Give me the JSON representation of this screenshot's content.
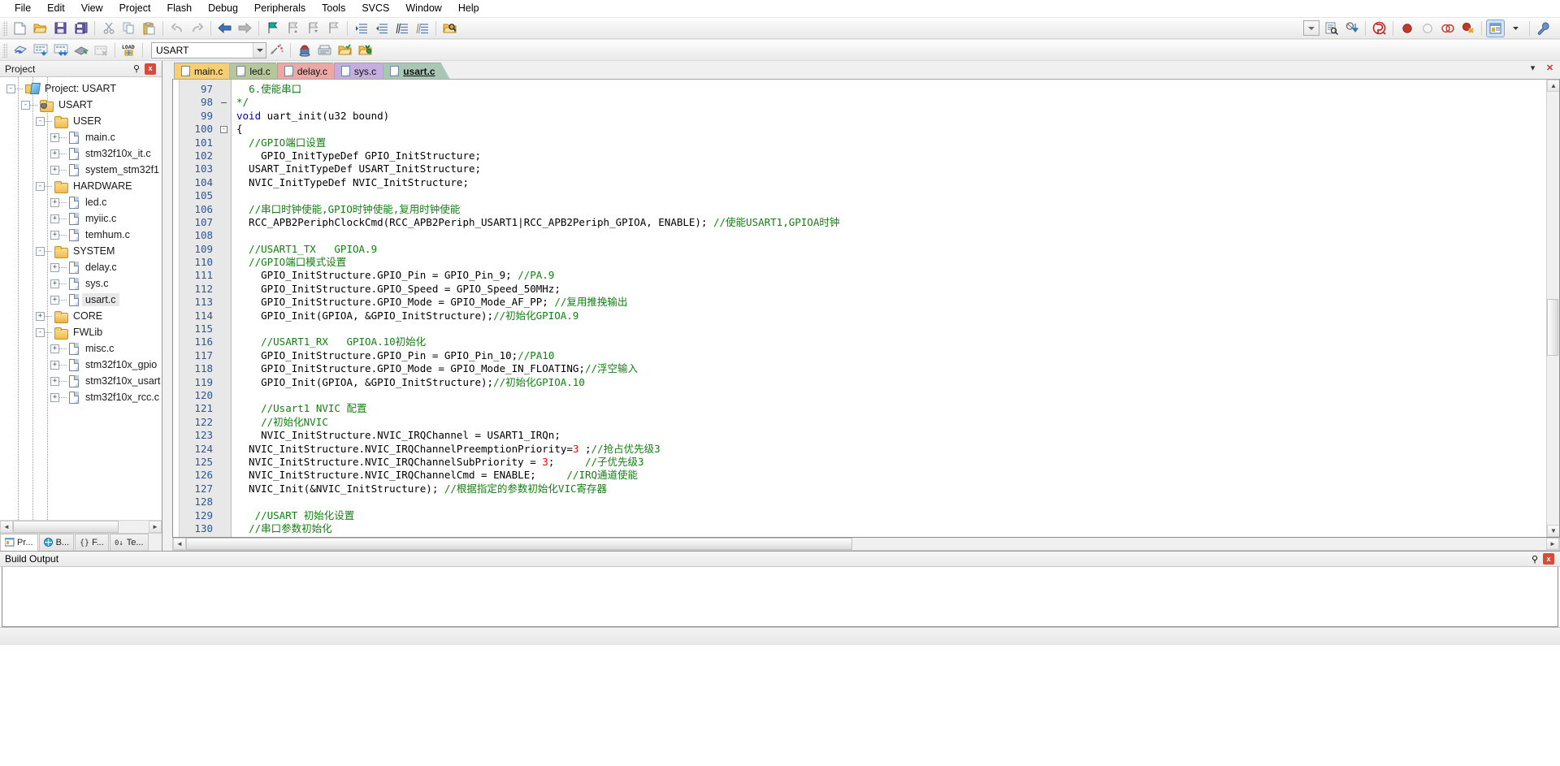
{
  "menubar": {
    "items": [
      {
        "label": "File"
      },
      {
        "label": "Edit"
      },
      {
        "label": "View"
      },
      {
        "label": "Project"
      },
      {
        "label": "Flash"
      },
      {
        "label": "Debug"
      },
      {
        "label": "Peripherals"
      },
      {
        "label": "Tools"
      },
      {
        "label": "SVCS"
      },
      {
        "label": "Window"
      },
      {
        "label": "Help"
      }
    ]
  },
  "toolbar1": {
    "icons": [
      "new-file-icon",
      "open-file-icon",
      "save-icon",
      "save-all-icon",
      "cut-icon",
      "copy-icon",
      "paste-icon",
      "undo-icon",
      "redo-icon",
      "navigate-back-icon",
      "navigate-forward-icon",
      "bookmark-toggle-icon",
      "bookmark-prev-icon",
      "bookmark-next-icon",
      "bookmark-clear-icon",
      "indent-icon",
      "outdent-icon",
      "comment-icon",
      "uncomment-icon",
      "find-in-files-icon",
      "dropdown-icon",
      "configure-icon",
      "debug-download-icon",
      "start-debug-icon",
      "insert-breakpoint-icon",
      "disable-breakpoint-icon",
      "kill-all-breakpoints-icon",
      "disable-all-breakpoints-icon",
      "project-window-icon",
      "project-window-dropdown-icon",
      "configure-target-icon"
    ]
  },
  "toolbar2": {
    "icons": [
      "translate-icon",
      "build-icon",
      "rebuild-icon",
      "batch-build-icon",
      "stop-build-icon",
      "load-icon"
    ],
    "target_select": {
      "value": "USART",
      "name": "target-select"
    },
    "right_icons": [
      "blank-icon",
      "manage-runtime-icon",
      "target-options-icon",
      "manage-project-icon",
      "pack-installer-icon"
    ]
  },
  "project_pane": {
    "title": "Project",
    "pin_label": "⚲",
    "close_label": "x",
    "tree": [
      {
        "depth": 0,
        "label": "Project: USART",
        "icon": "project-icon",
        "expander": "-",
        "selected": false
      },
      {
        "depth": 1,
        "label": "USART",
        "icon": "target-folder-icon",
        "expander": "-",
        "selected": false
      },
      {
        "depth": 2,
        "label": "USER",
        "icon": "folder-icon",
        "expander": "-",
        "selected": false
      },
      {
        "depth": 3,
        "label": "main.c",
        "icon": "c-file-icon",
        "expander": "+",
        "selected": false
      },
      {
        "depth": 3,
        "label": "stm32f10x_it.c",
        "icon": "c-file-icon",
        "expander": "+",
        "selected": false
      },
      {
        "depth": 3,
        "label": "system_stm32f1",
        "icon": "c-file-icon",
        "expander": "+",
        "selected": false
      },
      {
        "depth": 2,
        "label": "HARDWARE",
        "icon": "folder-icon",
        "expander": "-",
        "selected": false
      },
      {
        "depth": 3,
        "label": "led.c",
        "icon": "c-file-icon",
        "expander": "+",
        "selected": false
      },
      {
        "depth": 3,
        "label": "myiic.c",
        "icon": "c-file-icon",
        "expander": "+",
        "selected": false
      },
      {
        "depth": 3,
        "label": "temhum.c",
        "icon": "c-file-icon",
        "expander": "+",
        "selected": false
      },
      {
        "depth": 2,
        "label": "SYSTEM",
        "icon": "folder-icon",
        "expander": "-",
        "selected": false
      },
      {
        "depth": 3,
        "label": "delay.c",
        "icon": "c-file-icon",
        "expander": "+",
        "selected": false
      },
      {
        "depth": 3,
        "label": "sys.c",
        "icon": "c-file-icon",
        "expander": "+",
        "selected": false
      },
      {
        "depth": 3,
        "label": "usart.c",
        "icon": "c-file-icon",
        "expander": "+",
        "selected": true
      },
      {
        "depth": 2,
        "label": "CORE",
        "icon": "folder-closed-icon",
        "expander": "+",
        "selected": false
      },
      {
        "depth": 2,
        "label": "FWLib",
        "icon": "folder-icon",
        "expander": "-",
        "selected": false
      },
      {
        "depth": 3,
        "label": "misc.c",
        "icon": "c-file-icon",
        "expander": "+",
        "selected": false
      },
      {
        "depth": 3,
        "label": "stm32f10x_gpio",
        "icon": "c-file-icon",
        "expander": "+",
        "selected": false
      },
      {
        "depth": 3,
        "label": "stm32f10x_usart",
        "icon": "c-file-icon",
        "expander": "+",
        "selected": false
      },
      {
        "depth": 3,
        "label": "stm32f10x_rcc.c",
        "icon": "c-file-icon",
        "expander": "+",
        "selected": false
      }
    ],
    "bottom_tabs": [
      {
        "label": "Pr...",
        "icon": "project-tab-icon",
        "active": true
      },
      {
        "label": "B...",
        "icon": "books-tab-icon",
        "active": false
      },
      {
        "label": "F...",
        "icon": "functions-tab-icon",
        "active": false
      },
      {
        "label": "Te...",
        "icon": "templates-tab-icon",
        "active": false
      }
    ]
  },
  "editor": {
    "tabs": [
      {
        "label": "main.c",
        "color": "#f5cf72",
        "active": false
      },
      {
        "label": "led.c",
        "color": "#b6c89b",
        "active": false
      },
      {
        "label": "delay.c",
        "color": "#eda8a5",
        "active": false
      },
      {
        "label": "sys.c",
        "color": "#c5aede",
        "active": false
      },
      {
        "label": "usart.c",
        "color": "#a9c7b5",
        "active": true
      }
    ],
    "tab_controls": [
      {
        "name": "tab-list-dropdown-icon",
        "label": "▾"
      },
      {
        "name": "close-tab-icon",
        "label": "✕"
      }
    ],
    "first_line": 97,
    "lines": [
      {
        "n": 97,
        "fold": "",
        "segments": [
          {
            "t": "  ",
            "c": ""
          },
          {
            "t": "6.使能串口",
            "c": "cmt"
          }
        ]
      },
      {
        "n": 98,
        "fold": "|",
        "segments": [
          {
            "t": "*/",
            "c": "cmt"
          }
        ]
      },
      {
        "n": 99,
        "fold": "",
        "segments": [
          {
            "t": "void ",
            "c": "kw"
          },
          {
            "t": "uart_init(u32 bound)",
            "c": ""
          }
        ]
      },
      {
        "n": 100,
        "fold": "-",
        "segments": [
          {
            "t": "{",
            "c": ""
          }
        ]
      },
      {
        "n": 101,
        "fold": "",
        "segments": [
          {
            "t": "  //GPIO端口设置",
            "c": "cmt"
          }
        ]
      },
      {
        "n": 102,
        "fold": "",
        "segments": [
          {
            "t": "    GPIO_InitTypeDef GPIO_InitStructure;",
            "c": ""
          }
        ]
      },
      {
        "n": 103,
        "fold": "",
        "segments": [
          {
            "t": "  USART_InitTypeDef USART_InitStructure;",
            "c": ""
          }
        ]
      },
      {
        "n": 104,
        "fold": "",
        "segments": [
          {
            "t": "  NVIC_InitTypeDef NVIC_InitStructure;",
            "c": ""
          }
        ]
      },
      {
        "n": 105,
        "fold": "",
        "segments": [
          {
            "t": "",
            "c": ""
          }
        ]
      },
      {
        "n": 106,
        "fold": "",
        "segments": [
          {
            "t": "  //串口时钟使能,GPIO时钟使能,复用时钟使能",
            "c": "cmt"
          }
        ]
      },
      {
        "n": 107,
        "fold": "",
        "segments": [
          {
            "t": "  RCC_APB2PeriphClockCmd(RCC_APB2Periph_USART1|RCC_APB2Periph_GPIOA, ENABLE); ",
            "c": ""
          },
          {
            "t": "//使能USART1,GPIOA时钟",
            "c": "cmt"
          }
        ]
      },
      {
        "n": 108,
        "fold": "",
        "segments": [
          {
            "t": "",
            "c": ""
          }
        ]
      },
      {
        "n": 109,
        "fold": "",
        "segments": [
          {
            "t": "  //USART1_TX   GPIOA.9",
            "c": "cmt"
          }
        ]
      },
      {
        "n": 110,
        "fold": "",
        "segments": [
          {
            "t": "  //GPIO端口模式设置",
            "c": "cmt"
          }
        ]
      },
      {
        "n": 111,
        "fold": "",
        "segments": [
          {
            "t": "    GPIO_InitStructure.GPIO_Pin = GPIO_Pin_9; ",
            "c": ""
          },
          {
            "t": "//PA.9",
            "c": "cmt"
          }
        ]
      },
      {
        "n": 112,
        "fold": "",
        "segments": [
          {
            "t": "    GPIO_InitStructure.GPIO_Speed = GPIO_Speed_50MHz;",
            "c": ""
          }
        ]
      },
      {
        "n": 113,
        "fold": "",
        "segments": [
          {
            "t": "    GPIO_InitStructure.GPIO_Mode = GPIO_Mode_AF_PP; ",
            "c": ""
          },
          {
            "t": "//复用推挽输出",
            "c": "cmt"
          }
        ]
      },
      {
        "n": 114,
        "fold": "",
        "segments": [
          {
            "t": "    GPIO_Init(GPIOA, &GPIO_InitStructure);",
            "c": ""
          },
          {
            "t": "//初始化GPIOA.9",
            "c": "cmt"
          }
        ]
      },
      {
        "n": 115,
        "fold": "",
        "segments": [
          {
            "t": "",
            "c": ""
          }
        ]
      },
      {
        "n": 116,
        "fold": "",
        "segments": [
          {
            "t": "    //USART1_RX   GPIOA.10初始化",
            "c": "cmt"
          }
        ]
      },
      {
        "n": 117,
        "fold": "",
        "segments": [
          {
            "t": "    GPIO_InitStructure.GPIO_Pin = GPIO_Pin_10;",
            "c": ""
          },
          {
            "t": "//PA10",
            "c": "cmt"
          }
        ]
      },
      {
        "n": 118,
        "fold": "",
        "segments": [
          {
            "t": "    GPIO_InitStructure.GPIO_Mode = GPIO_Mode_IN_FLOATING;",
            "c": ""
          },
          {
            "t": "//浮空输入",
            "c": "cmt"
          }
        ]
      },
      {
        "n": 119,
        "fold": "",
        "segments": [
          {
            "t": "    GPIO_Init(GPIOA, &GPIO_InitStructure);",
            "c": ""
          },
          {
            "t": "//初始化GPIOA.10",
            "c": "cmt"
          }
        ]
      },
      {
        "n": 120,
        "fold": "",
        "segments": [
          {
            "t": "",
            "c": ""
          }
        ]
      },
      {
        "n": 121,
        "fold": "",
        "segments": [
          {
            "t": "    //Usart1 NVIC 配置",
            "c": "cmt"
          }
        ]
      },
      {
        "n": 122,
        "fold": "",
        "segments": [
          {
            "t": "    //初始化NVIC",
            "c": "cmt"
          }
        ]
      },
      {
        "n": 123,
        "fold": "",
        "segments": [
          {
            "t": "    NVIC_InitStructure.NVIC_IRQChannel = USART1_IRQn;",
            "c": ""
          }
        ]
      },
      {
        "n": 124,
        "fold": "",
        "segments": [
          {
            "t": "  NVIC_InitStructure.NVIC_IRQChannelPreemptionPriority=",
            "c": ""
          },
          {
            "t": "3",
            "c": "num"
          },
          {
            "t": " ;",
            "c": ""
          },
          {
            "t": "//抢占优先级3",
            "c": "cmt"
          }
        ]
      },
      {
        "n": 125,
        "fold": "",
        "segments": [
          {
            "t": "  NVIC_InitStructure.NVIC_IRQChannelSubPriority = ",
            "c": ""
          },
          {
            "t": "3",
            "c": "num"
          },
          {
            "t": ";     ",
            "c": ""
          },
          {
            "t": "//子优先级3",
            "c": "cmt"
          }
        ]
      },
      {
        "n": 126,
        "fold": "",
        "segments": [
          {
            "t": "  NVIC_InitStructure.NVIC_IRQChannelCmd = ENABLE;     ",
            "c": ""
          },
          {
            "t": "//IRQ通道使能",
            "c": "cmt"
          }
        ]
      },
      {
        "n": 127,
        "fold": "",
        "segments": [
          {
            "t": "  NVIC_Init(&NVIC_InitStructure); ",
            "c": ""
          },
          {
            "t": "//根据指定的参数初始化VIC寄存器",
            "c": "cmt"
          }
        ]
      },
      {
        "n": 128,
        "fold": "",
        "segments": [
          {
            "t": "",
            "c": ""
          }
        ]
      },
      {
        "n": 129,
        "fold": "",
        "segments": [
          {
            "t": "   //USART 初始化设置",
            "c": "cmt"
          }
        ]
      },
      {
        "n": 130,
        "fold": "",
        "segments": [
          {
            "t": "  //串口参数初始化",
            "c": "cmt"
          }
        ]
      }
    ]
  },
  "build_output": {
    "title": "Build Output",
    "pin_label": "⚲",
    "close_label": "x",
    "content": ""
  },
  "colors": {
    "keyword": "#0000c8",
    "comment": "#148014",
    "number": "#ff0000",
    "linenum": "#32568d",
    "gutter_bg": "#e8e8e8",
    "selection": "#e8e8e8"
  }
}
